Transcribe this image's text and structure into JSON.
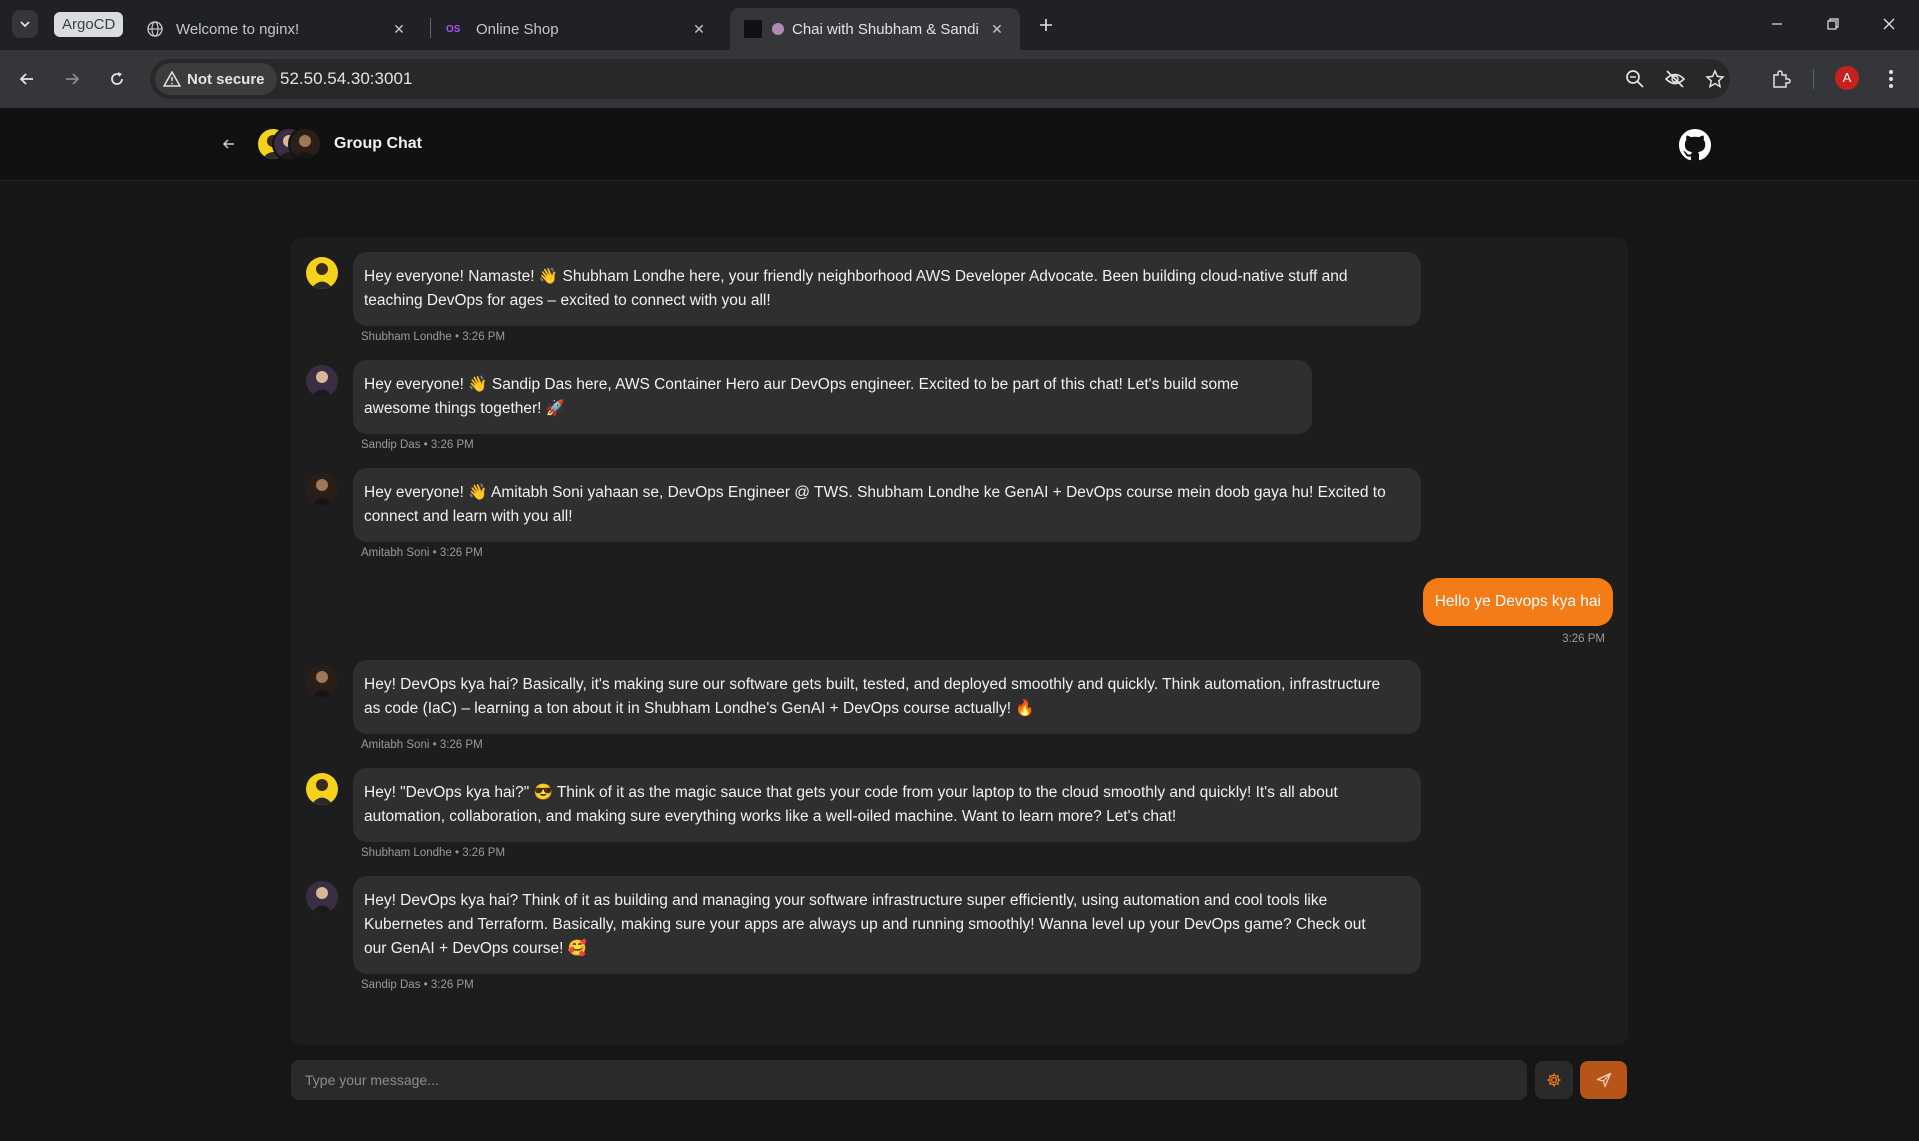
{
  "browser": {
    "group_label": "ArgoCD",
    "tabs": [
      {
        "title": "Welcome to nginx!",
        "active": false
      },
      {
        "title": "Online Shop",
        "favicon_text": "OS",
        "active": false
      },
      {
        "title": "Chai with Shubham & Sandi",
        "active": true
      }
    ],
    "security_label": "Not secure",
    "url": "52.50.54.30:3001",
    "profile_initial": "A"
  },
  "header": {
    "title": "Group Chat"
  },
  "messages": [
    {
      "sender": "Shubham Londhe",
      "time": "3:26 PM",
      "meta": "Shubham Londhe • 3:26 PM",
      "line1": "Hey everyone! Namaste! 👋 Shubham Londhe here, your friendly neighborhood AWS Developer Advocate. Been building cloud-native stuff and",
      "line2": "teaching DevOps for ages – excited to connect with you all!"
    },
    {
      "sender": "Sandip Das",
      "time": "3:26 PM",
      "meta": "Sandip Das • 3:26 PM",
      "line1": "Hey everyone!  👋 Sandip Das here, AWS Container Hero aur DevOps engineer. Excited to be part of this chat! Let's build some",
      "line2": "awesome things together! 🚀"
    },
    {
      "sender": "Amitabh Soni",
      "time": "3:26 PM",
      "meta": "Amitabh Soni • 3:26 PM",
      "line1": "Hey everyone!  👋 Amitabh Soni yahaan se, DevOps Engineer @ TWS. Shubham Londhe ke GenAI + DevOps course mein doob gaya hu! Excited to",
      "line2": "connect and learn with you all!"
    },
    {
      "sender": "Amitabh Soni",
      "time": "3:26 PM",
      "meta": "Amitabh Soni • 3:26 PM",
      "line1": "Hey! DevOps kya hai? Basically, it's making sure our software gets built, tested, and deployed smoothly and quickly. Think automation, infrastructure",
      "line2": "as code (IaC) – learning a ton about it in Shubham Londhe's GenAI + DevOps course actually! 🔥"
    },
    {
      "sender": "Shubham Londhe",
      "time": "3:26 PM",
      "meta": "Shubham Londhe • 3:26 PM",
      "line1": "Hey! \"DevOps kya hai?\" 😎 Think of it as the magic sauce that gets your code from your laptop to the cloud smoothly and quickly! It's all about",
      "line2": "automation, collaboration, and making sure everything works like a well-oiled machine. Want to learn more? Let's chat!"
    },
    {
      "sender": "Sandip Das",
      "time": "3:26 PM",
      "meta": "Sandip Das • 3:26 PM",
      "line1": "Hey! DevOps kya hai? Think of it as building and managing your software infrastructure super efficiently, using automation and cool tools like",
      "line2": "Kubernetes and Terraform. Basically, making sure your apps are always up and running smoothly! Wanna level up your DevOps game? Check out",
      "line3": "our GenAI + DevOps course! 🥰"
    }
  ],
  "outgoing": {
    "text": "Hello ye Devops kya hai",
    "time": "3:26 PM"
  },
  "composer": {
    "placeholder": "Type your message..."
  },
  "colors": {
    "accent": "#f57b17",
    "send_button": "#b6541a",
    "background": "#161616",
    "panel": "#1d1d1d",
    "bubble": "#2f2f2f"
  }
}
